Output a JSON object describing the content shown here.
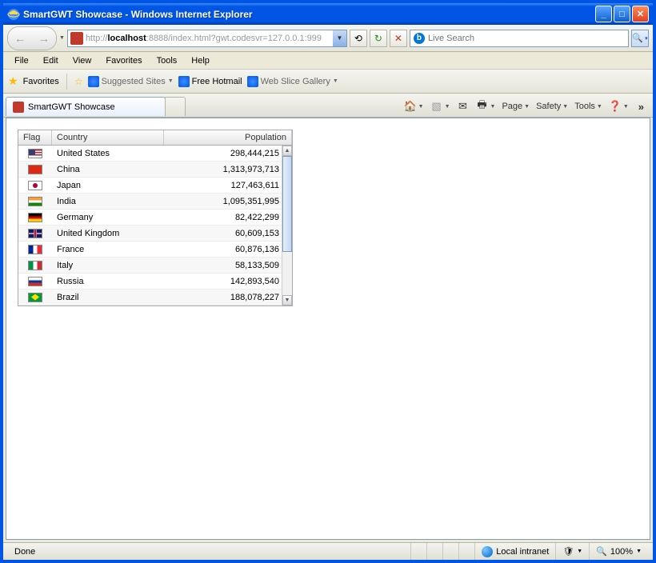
{
  "window": {
    "title": "SmartGWT Showcase - Windows Internet Explorer"
  },
  "address": {
    "prefix": "http://",
    "host": "localhost",
    "rest": ":8888/index.html?gwt.codesvr=127.0.0.1:999"
  },
  "search": {
    "placeholder": "Live Search"
  },
  "menus": [
    "File",
    "Edit",
    "View",
    "Favorites",
    "Tools",
    "Help"
  ],
  "favbar": {
    "label": "Favorites",
    "suggested": "Suggested Sites",
    "hotmail": "Free Hotmail",
    "webslice": "Web Slice Gallery"
  },
  "tab": {
    "title": "SmartGWT Showcase"
  },
  "cmdbar": {
    "page": "Page",
    "safety": "Safety",
    "tools": "Tools"
  },
  "grid": {
    "headers": {
      "flag": "Flag",
      "country": "Country",
      "population": "Population"
    },
    "rows": [
      {
        "flag": "us",
        "country": "United States",
        "population": "298,444,215"
      },
      {
        "flag": "cn",
        "country": "China",
        "population": "1,313,973,713"
      },
      {
        "flag": "jp",
        "country": "Japan",
        "population": "127,463,611"
      },
      {
        "flag": "in",
        "country": "India",
        "population": "1,095,351,995"
      },
      {
        "flag": "de",
        "country": "Germany",
        "population": "82,422,299"
      },
      {
        "flag": "gb",
        "country": "United Kingdom",
        "population": "60,609,153"
      },
      {
        "flag": "fr",
        "country": "France",
        "population": "60,876,136"
      },
      {
        "flag": "it",
        "country": "Italy",
        "population": "58,133,509"
      },
      {
        "flag": "ru",
        "country": "Russia",
        "population": "142,893,540"
      },
      {
        "flag": "br",
        "country": "Brazil",
        "population": "188,078,227"
      }
    ]
  },
  "status": {
    "done": "Done",
    "zone": "Local intranet",
    "zoom": "100%"
  }
}
